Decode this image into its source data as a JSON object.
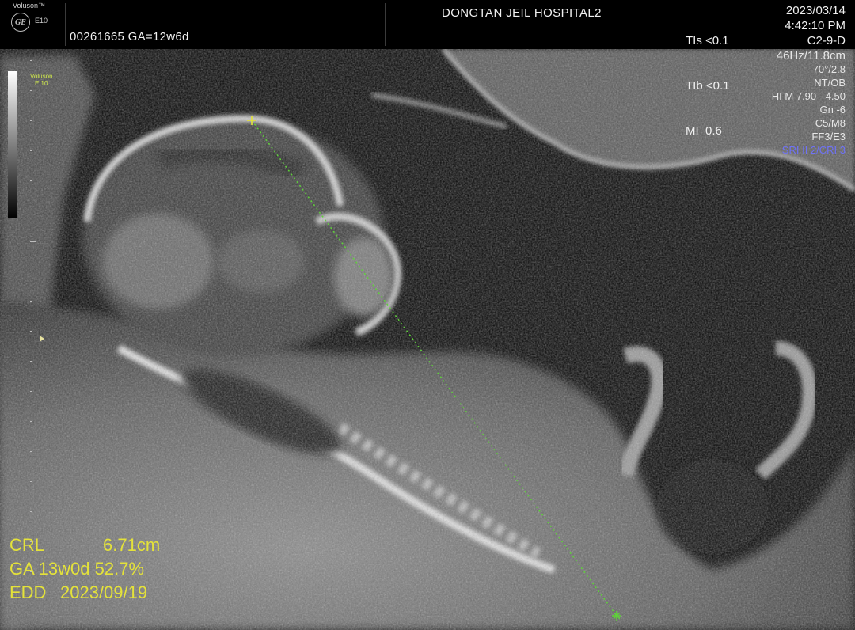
{
  "header": {
    "brand": "Voluson™",
    "logo": "GE",
    "model": "E10",
    "patient": "00261665   GA=12w6d",
    "hospital": "DONGTAN JEIL HOSPITAL2",
    "tis": "TIs <0.1",
    "tib": "TIb <0.1",
    "mi": "MI  0.6",
    "date": "2023/03/14",
    "time": "4:42:10 PM",
    "probe": "C2-9-D"
  },
  "params": [
    "46Hz/11.8cm",
    "70°/2.8",
    "NT/OB",
    "HI M  7.90 - 4.50",
    "Gn  -6",
    "C5/M8",
    "FF3/E3",
    "SRI II 2/CRI 3"
  ],
  "scale_label": [
    "Voluson",
    "E 10"
  ],
  "measurement": {
    "crl_label": "CRL",
    "crl_value": "6.71cm",
    "ga": "GA 13w0d 52.7%",
    "edd_label": "EDD",
    "edd_value": "2023/09/19"
  },
  "colors": {
    "measurement": "#e4e23a",
    "caliper": "#5fd13a",
    "sri": "#6f72f5"
  },
  "icons": {
    "logo": "ge-logo-icon",
    "focus": "focus-marker-icon",
    "caliper_start": "caliper-plus-icon",
    "caliper_end": "caliper-star-icon"
  }
}
